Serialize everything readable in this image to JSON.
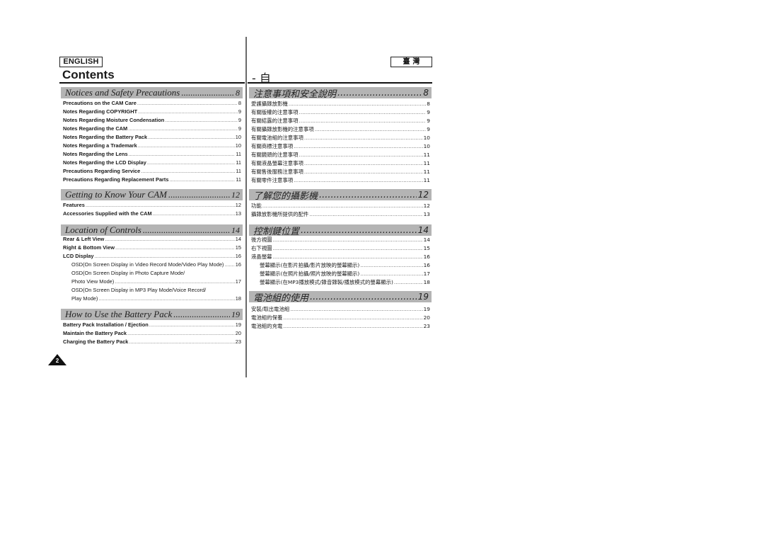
{
  "left": {
    "language_label": "ENGLISH",
    "title": "Contents",
    "sections": [
      {
        "title": "Notices and Safety Precautions",
        "page": "8",
        "items": [
          {
            "label": "Precautions on the CAM Care",
            "page": "8"
          },
          {
            "label": "Notes Regarding COPYRIGHT",
            "page": "9"
          },
          {
            "label": "Notes Regarding Moisture Condensation",
            "page": "9"
          },
          {
            "label": "Notes Regarding the CAM",
            "page": "9"
          },
          {
            "label": "Notes Regarding the Battery Pack",
            "page": "10"
          },
          {
            "label": "Notes Regarding a Trademark",
            "page": "10"
          },
          {
            "label": "Notes Regarding the Lens",
            "page": "11"
          },
          {
            "label": "Notes Regarding the LCD Display",
            "page": "11"
          },
          {
            "label": "Precautions Regarding Service",
            "page": "11"
          },
          {
            "label": "Precautions Regarding Replacement Parts",
            "page": "11"
          }
        ]
      },
      {
        "title": "Getting to Know Your CAM",
        "page": "12",
        "items": [
          {
            "label": "Features",
            "page": "12"
          },
          {
            "label": "Accessories Supplied with the CAM",
            "page": "13"
          }
        ]
      },
      {
        "title": "Location of Controls",
        "page": "14",
        "items": [
          {
            "label": "Rear & Left View",
            "page": "14"
          },
          {
            "label": "Right & Bottom View",
            "page": "15"
          },
          {
            "label": "LCD Display",
            "page": "16"
          },
          {
            "label": "OSD(On Screen Display in Video Record Mode/Video Play Mode)",
            "page": "16",
            "sub": true
          },
          {
            "label": "OSD(On Screen Display in Photo Capture Mode/",
            "page": "",
            "sub": true
          },
          {
            "label": "Photo View Mode)",
            "page": "17",
            "sub": true
          },
          {
            "label": "OSD(On Screen Display in MP3 Play Mode/Voice Record/",
            "page": "",
            "sub": true
          },
          {
            "label": "Play Mode)",
            "page": "18",
            "sub": true
          }
        ]
      },
      {
        "title": "How to Use the Battery Pack",
        "page": "19",
        "items": [
          {
            "label": "Battery Pack Installation / Ejection",
            "page": "19"
          },
          {
            "label": "Maintain the Battery Pack",
            "page": "20"
          },
          {
            "label": "Charging the Battery Pack",
            "page": "23"
          }
        ]
      }
    ],
    "page_number": "2"
  },
  "right": {
    "language_label": "臺 灣",
    "title": "- 自",
    "sections": [
      {
        "title": "注意事項和安全說明",
        "page": "8",
        "items": [
          {
            "label": "愛護攝錄放影機",
            "page": "8"
          },
          {
            "label": "有關版權的注意事項",
            "page": "9"
          },
          {
            "label": "有關結露的注意事項",
            "page": "9"
          },
          {
            "label": "有關攝錄放影機的注意事項",
            "page": "9"
          },
          {
            "label": "有關電池組的注意事項",
            "page": "10"
          },
          {
            "label": "有關商標注意事項",
            "page": "10"
          },
          {
            "label": "有關鏡頭的注意事項",
            "page": "11"
          },
          {
            "label": "有關液晶螢幕注意事項",
            "page": "11"
          },
          {
            "label": "有關售後服務注意事項",
            "page": "11"
          },
          {
            "label": "有關零件注意事項",
            "page": "11"
          }
        ]
      },
      {
        "title": "了解您的攝影機",
        "page": "12",
        "items": [
          {
            "label": "功能",
            "page": "12"
          },
          {
            "label": "攝錄放影機所提供的配件",
            "page": "13"
          }
        ]
      },
      {
        "title": "控制鍵位置",
        "page": "14",
        "items": [
          {
            "label": "後方視圖",
            "page": "14"
          },
          {
            "label": "右下視圖",
            "page": "15"
          },
          {
            "label": "液晶螢幕",
            "page": "16"
          },
          {
            "label": "螢幕顯示(在影片拍攝/影片放映的螢幕顯示)",
            "page": "16",
            "sub": true
          },
          {
            "label": "螢幕顯示(在照片拍攝/照片放映的螢幕顯示)",
            "page": "17",
            "sub": true
          },
          {
            "label": "螢幕顯示(在MP3播放模式/錄音錄製/播放模式的螢幕顯示)",
            "page": "18",
            "sub": true
          }
        ]
      },
      {
        "title": "電池組的使用",
        "page": "19",
        "items": [
          {
            "label": "安裝/取出電池組",
            "page": "19"
          },
          {
            "label": "電池組的保養",
            "page": "20"
          },
          {
            "label": "電池組的充電",
            "page": "23"
          }
        ]
      }
    ]
  }
}
